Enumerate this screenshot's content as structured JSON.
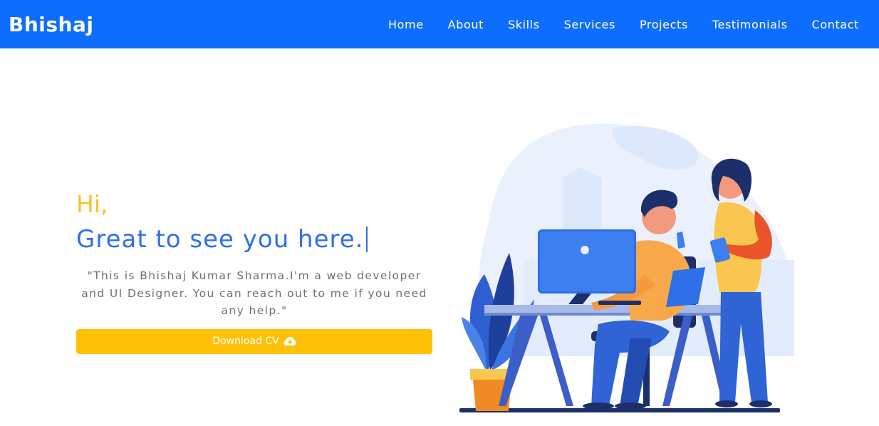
{
  "navbar": {
    "brand": "Bhishaj",
    "links": [
      "Home",
      "About",
      "Skills",
      "Services",
      "Projects",
      "Testimonials",
      "Contact"
    ]
  },
  "hero": {
    "greeting": "Hi,",
    "headline": "Great to see you here.",
    "intro": "\"This is Bhishaj Kumar Sharma.I'm a web developer and UI Designer. You can reach out to me if you need any help.\"",
    "download_label": "Download CV",
    "download_icon": "cloud-download-icon"
  },
  "colors": {
    "primary": "#0d6efd",
    "accent": "#ffc107",
    "headline": "#2f6fe8",
    "greeting": "#f7c22a"
  }
}
